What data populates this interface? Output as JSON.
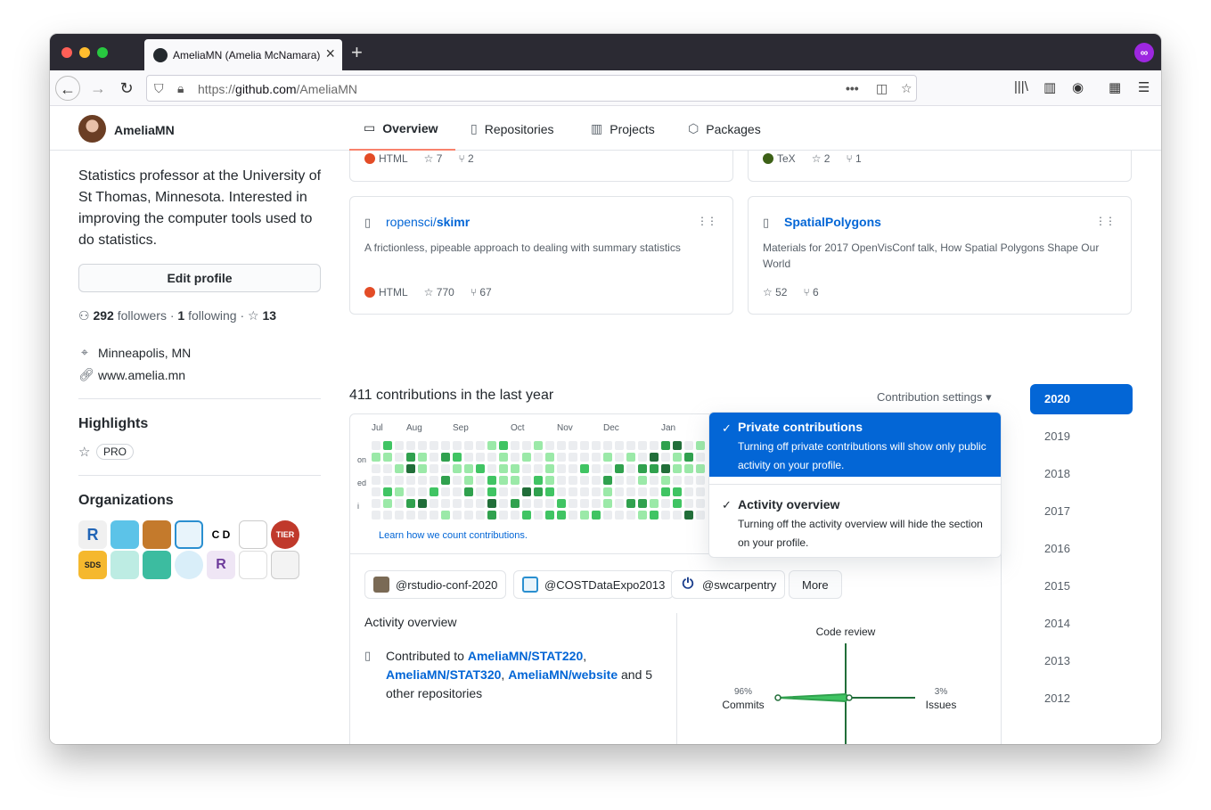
{
  "browser": {
    "tab_title": "AmeliaMN (Amelia McNamara)",
    "url_prefix": "https://",
    "url_host": "github.com",
    "url_path": "/AmeliaMN"
  },
  "header": {
    "username": "AmeliaMN",
    "tabs": [
      {
        "label": "Overview",
        "icon": "book-icon"
      },
      {
        "label": "Repositories",
        "icon": "repo-icon"
      },
      {
        "label": "Projects",
        "icon": "project-icon"
      },
      {
        "label": "Packages",
        "icon": "package-icon"
      }
    ]
  },
  "sidebar": {
    "bio": "Statistics professor at the University of St Thomas, Minnesota. Interested in improving the computer tools used to do statistics.",
    "edit_profile": "Edit profile",
    "followers_count": "292",
    "followers_label": "followers",
    "following_count": "1",
    "following_label": "following",
    "stars_count": "13",
    "location": "Minneapolis, MN",
    "website": "www.amelia.mn",
    "highlights_title": "Highlights",
    "pro_badge": "PRO",
    "organizations_title": "Organizations"
  },
  "repos": {
    "top_left": {
      "language": "HTML",
      "lang_color": "#e34c26",
      "stars": "7",
      "forks": "2"
    },
    "top_right": {
      "language": "TeX",
      "lang_color": "#3D6117",
      "stars": "2",
      "forks": "1"
    },
    "left": {
      "owner": "ropensci/",
      "name": "skimr",
      "description": "A frictionless, pipeable approach to dealing with summary statistics",
      "language": "HTML",
      "lang_color": "#e34c26",
      "stars": "770",
      "forks": "67"
    },
    "right": {
      "owner": "",
      "name": "SpatialPolygons",
      "description": "Materials for 2017 OpenVisConf talk, How Spatial Polygons Shape Our World",
      "stars": "52",
      "forks": "6"
    }
  },
  "contributions": {
    "title": "411 contributions in the last year",
    "settings_label": "Contribution settings",
    "months": [
      "Jul",
      "Aug",
      "Sep",
      "Oct",
      "Nov",
      "Dec",
      "Jan"
    ],
    "day_labels": [
      "on",
      "ed",
      "i"
    ],
    "learn_link": "Learn how we count contributions."
  },
  "dropdown": {
    "private_title": "Private contributions",
    "private_desc": "Turning off private contributions will show only public activity on your profile.",
    "activity_title": "Activity overview",
    "activity_desc": "Turning off the activity overview will hide the section on your profile."
  },
  "years": [
    "2020",
    "2019",
    "2018",
    "2017",
    "2016",
    "2015",
    "2014",
    "2013",
    "2012"
  ],
  "activity": {
    "org_chips": [
      "@rstudio-conf-2020",
      "@COSTDataExpo2013",
      "@swcarpentry"
    ],
    "more_label": "More",
    "heading": "Activity overview",
    "contributed_to": "Contributed to",
    "repo1": "AmeliaMN/STAT220",
    "repo2": "AmeliaMN/STAT320",
    "repo3": "AmeliaMN/website",
    "other": "and 5 other repositories",
    "chart": {
      "code_review_label": "Code review",
      "commits_pct": "96%",
      "commits_label": "Commits",
      "issues_pct": "3%",
      "issues_label": "Issues"
    }
  },
  "colors": {
    "accent": "#0366d6",
    "tab_underline": "#f9826c",
    "green_levels": [
      "#ebedf0",
      "#9be9a8",
      "#40c463",
      "#30a14e",
      "#216e39"
    ]
  }
}
